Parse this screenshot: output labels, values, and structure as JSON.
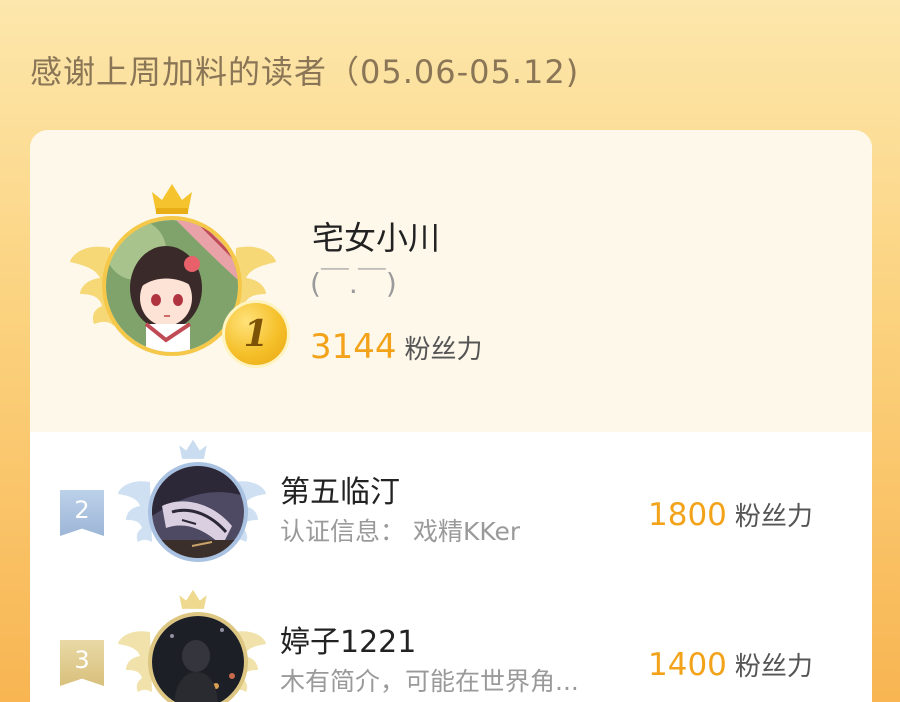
{
  "header": {
    "title": "感谢上周加料的读者（05.06-05.12)"
  },
  "top_reader": {
    "rank": "1",
    "name": "宅女小川",
    "bio": "(￣.￣)",
    "score": "3144",
    "score_unit": "粉丝力",
    "avatar_icon": "anime-girl-avatar-icon"
  },
  "readers": [
    {
      "rank": "2",
      "name": "第五临汀",
      "bio": "认证信息：  戏精KKer",
      "score": "1800",
      "score_unit": "粉丝力",
      "avatar_icon": "sleeping-figure-avatar-icon"
    },
    {
      "rank": "3",
      "name": "婷子1221",
      "bio": "木有简介，可能在世界角...",
      "score": "1400",
      "score_unit": "粉丝力",
      "avatar_icon": "night-silhouette-avatar-icon"
    }
  ],
  "colors": {
    "accent_orange": "#f2a31a",
    "gold": "#f5c84a",
    "silver": "#a9c2e2",
    "bronze": "#dcc681",
    "title_brown": "#8a7656"
  }
}
